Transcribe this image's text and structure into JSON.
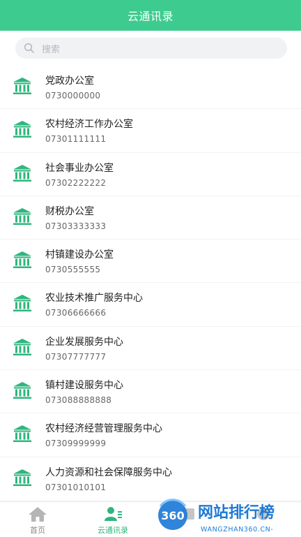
{
  "header": {
    "title": "云通讯录"
  },
  "search": {
    "placeholder": "搜索"
  },
  "contacts": [
    {
      "name": "党政办公室",
      "phone": "0730000000"
    },
    {
      "name": "农村经济工作办公室",
      "phone": "07301111111"
    },
    {
      "name": "社会事业办公室",
      "phone": "07302222222"
    },
    {
      "name": "财税办公室",
      "phone": "07303333333"
    },
    {
      "name": "村镇建设办公室",
      "phone": "0730555555"
    },
    {
      "name": "农业技术推广服务中心",
      "phone": "07306666666"
    },
    {
      "name": "企业发展服务中心",
      "phone": "07307777777"
    },
    {
      "name": "镇村建设服务中心",
      "phone": "073088888888"
    },
    {
      "name": "农村经济经营管理服务中心",
      "phone": "07309999999"
    },
    {
      "name": "人力资源和社会保障服务中心",
      "phone": "07301010101"
    }
  ],
  "tabbar": {
    "tabs": [
      {
        "label": "首页",
        "icon": "home-icon",
        "active": false
      },
      {
        "label": "云通讯录",
        "icon": "contacts-icon",
        "active": true
      },
      {
        "label": "",
        "icon": "tab3-icon",
        "active": false
      },
      {
        "label": "",
        "icon": "tab4-icon",
        "active": false
      }
    ]
  },
  "watermark": {
    "brand_number": "360",
    "brand_name": "网站排行榜",
    "url": "WANGZHAN360.CN-"
  },
  "colors": {
    "primary": "#3ecb8f",
    "icon_green": "#2fb67d",
    "active_tab": "#2fb67d",
    "watermark_blue": "#1e7ad6"
  }
}
